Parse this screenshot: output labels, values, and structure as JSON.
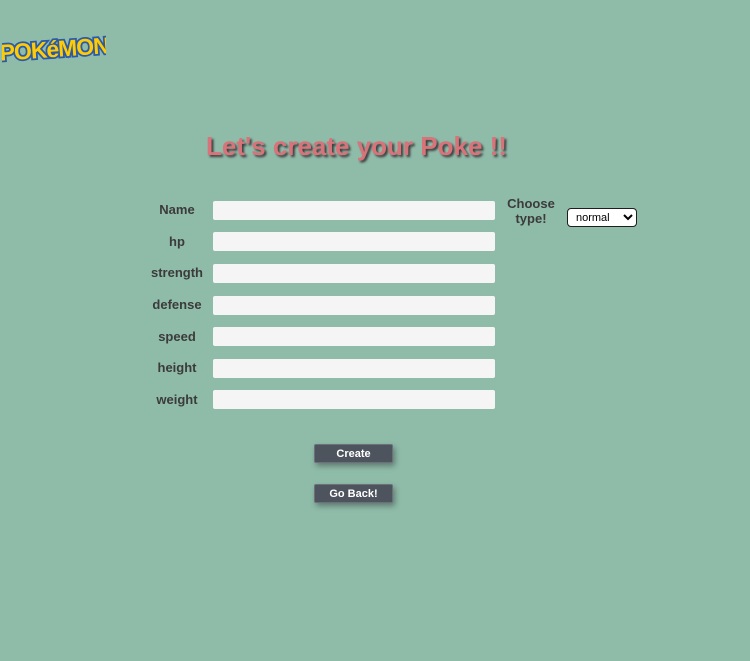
{
  "logo": {
    "text": "POKéMON"
  },
  "page": {
    "title": "Let's create your Poke !!"
  },
  "form": {
    "fields": [
      {
        "label": "Name",
        "value": "",
        "placeholder": ""
      },
      {
        "label": "hp",
        "value": "",
        "placeholder": ""
      },
      {
        "label": "strength",
        "value": "",
        "placeholder": ""
      },
      {
        "label": "defense",
        "value": "",
        "placeholder": ""
      },
      {
        "label": "speed",
        "value": "",
        "placeholder": ""
      },
      {
        "label": "height",
        "value": "",
        "placeholder": ""
      },
      {
        "label": "weight",
        "value": "",
        "placeholder": ""
      }
    ],
    "type": {
      "label_line1": "Choose",
      "label_line2": "type!",
      "selected": "normal"
    },
    "create_label": "Create",
    "back_label": "Go Back!"
  },
  "colors": {
    "background": "#8fbba9",
    "title": "#d9737a",
    "input_bg": "#f5f5f5",
    "button_bg": "#4e545e",
    "logo_yellow": "#ffcb05",
    "logo_blue": "#2a5aa8"
  }
}
